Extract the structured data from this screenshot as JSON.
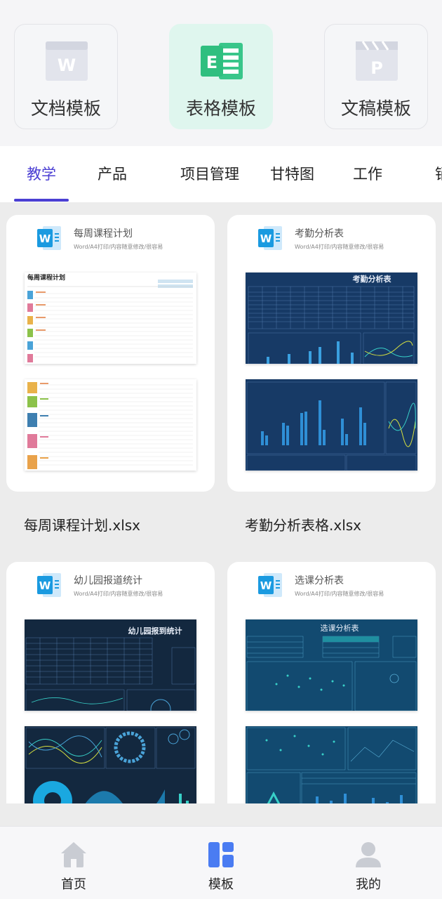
{
  "categories": [
    {
      "label": "文档模板",
      "icon": "word-doc-icon",
      "icon_letter": "W",
      "active": false
    },
    {
      "label": "表格模板",
      "icon": "spreadsheet-icon",
      "icon_letter": "E",
      "active": true
    },
    {
      "label": "文稿模板",
      "icon": "presentation-icon",
      "icon_letter": "P",
      "active": false
    }
  ],
  "tabs": [
    {
      "label": "教学",
      "active": true
    },
    {
      "label": "产品",
      "active": false
    },
    {
      "label": "项目管理",
      "active": false
    },
    {
      "label": "甘特图",
      "active": false
    },
    {
      "label": "工作",
      "active": false
    },
    {
      "label": "销",
      "active": false
    }
  ],
  "templates": [
    {
      "title": "每周课程计划",
      "subtitle": "Word/A4打印/内容随意修改/很容易",
      "filename": "每周课程计划.xlsx",
      "preview_title": "每周课程计划",
      "style": "light"
    },
    {
      "title": "考勤分析表",
      "subtitle": "Word/A4打印/内容随意修改/很容易",
      "filename": "考勤分析表格.xlsx",
      "preview_title": "考勤分析表",
      "style": "dark"
    },
    {
      "title": "幼儿园报道统计",
      "subtitle": "Word/A4打印/内容随意修改/很容易",
      "filename": "",
      "preview_title": "幼儿园报到统计",
      "style": "dark"
    },
    {
      "title": "选课分析表",
      "subtitle": "Word/A4打印/内容随意修改/很容易",
      "filename": "",
      "preview_title": "选课分析表",
      "style": "dark"
    }
  ],
  "bottom_nav": [
    {
      "label": "首页",
      "icon": "home-icon",
      "active": false
    },
    {
      "label": "模板",
      "icon": "template-icon",
      "active": true
    },
    {
      "label": "我的",
      "icon": "profile-icon",
      "active": false
    }
  ],
  "colors": {
    "accent": "#4b3fd3",
    "nav_active": "#4a7cf2",
    "nav_inactive": "#c9ccd3",
    "spreadsheet_green": "#2fbf7f",
    "dark_sheet_bg": "#14315a",
    "word_blue": "#1a9ae0"
  }
}
